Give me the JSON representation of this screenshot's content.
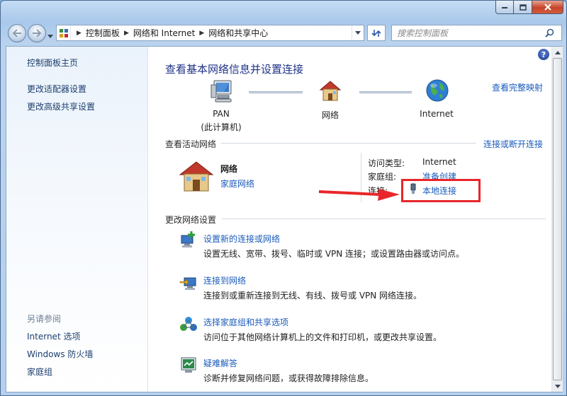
{
  "window": {
    "caption_buttons": [
      "minimize",
      "maximize",
      "close"
    ]
  },
  "nav": {
    "breadcrumbs": [
      "控制面板",
      "网络和 Internet",
      "网络和共享中心"
    ],
    "search_placeholder": "搜索控制面板"
  },
  "sidebar": {
    "items": [
      "控制面板主页",
      "更改适配器设置",
      "更改高级共享设置"
    ],
    "see_also_heading": "另请参阅",
    "see_also": [
      "Internet 选项",
      "Windows 防火墙",
      "家庭组"
    ]
  },
  "main": {
    "title": "查看基本网络信息并设置连接",
    "view_full_map": "查看完整映射",
    "map": {
      "nodes": [
        {
          "label": "PAN",
          "sublabel": "(此计算机)",
          "icon": "computer-icon"
        },
        {
          "label": "网络",
          "icon": "house-icon"
        },
        {
          "label": "Internet",
          "icon": "globe-icon"
        }
      ]
    },
    "active_section": {
      "heading": "查看活动网络",
      "connect_link": "连接或断开连接",
      "network_name": "网络",
      "network_type": "家庭网络",
      "access_type_label": "访问类型:",
      "access_type_value": "Internet",
      "homegroup_label": "家庭组:",
      "homegroup_value": "准备创建",
      "connections_label": "连接:",
      "connections_value": "本地连接"
    },
    "change_section": {
      "heading": "更改网络设置",
      "tasks": [
        {
          "title": "设置新的连接或网络",
          "desc": "设置无线、宽带、拨号、临时或 VPN 连接；或设置路由器或访问点。",
          "icon": "new-connection-icon"
        },
        {
          "title": "连接到网络",
          "desc": "连接到或重新连接到无线、有线、拨号或 VPN 网络连接。",
          "icon": "connect-network-icon"
        },
        {
          "title": "选择家庭组和共享选项",
          "desc": "访问位于其他网络计算机上的文件和打印机，或更改共享设置。",
          "icon": "homegroup-icon"
        },
        {
          "title": "疑难解答",
          "desc": "诊断并修复网络问题，或获得故障排除信息。",
          "icon": "troubleshoot-icon"
        }
      ]
    }
  },
  "colors": {
    "link": "#1a5bbb",
    "title": "#1e3287",
    "highlight": "#e8262a",
    "arrow": "#e8262a"
  }
}
